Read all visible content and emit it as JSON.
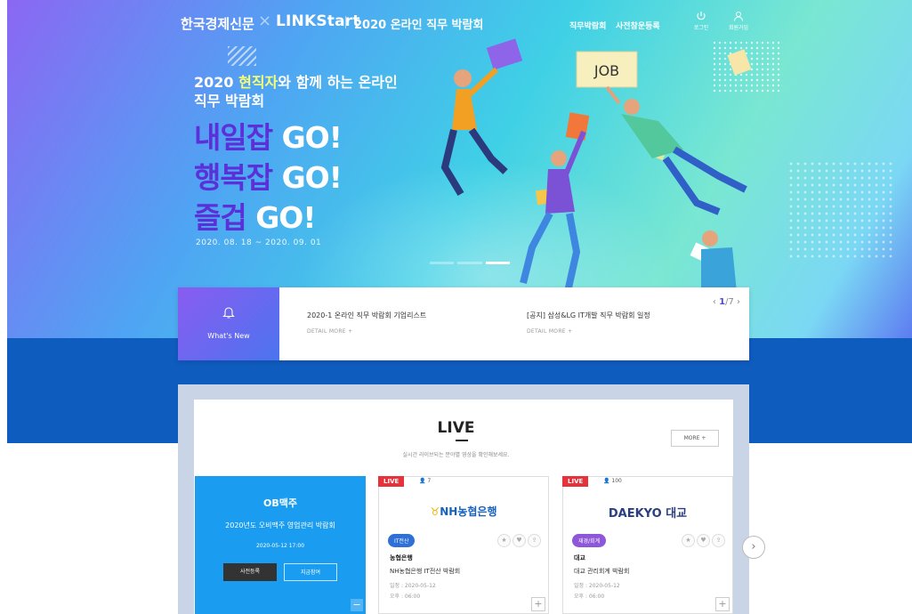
{
  "nav": {
    "brand_hk": "한국경제신문",
    "brand_x": "×",
    "brand_ls": "LINKStart",
    "brand_fair": "2020 온라인 직무 박람회",
    "menu": [
      "직무박람회",
      "사전참운등록"
    ],
    "icons": [
      {
        "name": "power-icon",
        "label": "로그인"
      },
      {
        "name": "user-icon",
        "label": "회원가입"
      }
    ]
  },
  "hero": {
    "sub_pre": "2020 ",
    "sub_highlight": "현직자",
    "sub_post": "와 함께 하는 온라인",
    "sub_line2": "직무 박람회",
    "lines": [
      {
        "ko": "내일잡 ",
        "go": "GO!"
      },
      {
        "ko": "행복잡 ",
        "go": "GO!"
      },
      {
        "ko": "즐겁 ",
        "go": "GO!"
      }
    ],
    "date": "2020. 08. 18 ~ 2020. 09. 01",
    "job_sign": "JOB",
    "accent": "#5b30d9"
  },
  "news": {
    "tag": "What's New",
    "page_current": "1",
    "page_total": "/7",
    "items": [
      {
        "title": "2020-1 온라인 직무 박람회 기업리스트",
        "more": "DETAIL MORE  +"
      },
      {
        "title": "[공지] 삼성&LG IT개발 직무 박람회 일정",
        "more": "DETAIL MORE  +"
      }
    ]
  },
  "live": {
    "title": "LIVE",
    "desc": "실시간 라이브되는 분야별 영상을 확인해보세요.",
    "more": "MORE  +",
    "featured": {
      "name": "OB맥주",
      "fair": "2020년도 오비맥주 영업관리 박람회",
      "time": "2020-05-12    17:00",
      "btn_register": "사전등록",
      "btn_join": "지금참여"
    },
    "cards": [
      {
        "badge": "LIVE",
        "viewers": "7",
        "logo_mark": "♉",
        "logo": "NH농협은행",
        "category": "IT전산",
        "company": "농협은행",
        "fair": "NH농협은행 IT전산 박람회",
        "date": "일정 : 2020-05-12",
        "time": "오후 : 06:00"
      },
      {
        "badge": "LIVE",
        "viewers": "100",
        "logo_mark": "",
        "logo": "DAEKYO 대교",
        "category": "재경/회계",
        "company": "대교",
        "fair": "대교 관리회계 박람회",
        "date": "일정 : 2020-05-12",
        "time": "오후 : 06:00"
      }
    ]
  }
}
